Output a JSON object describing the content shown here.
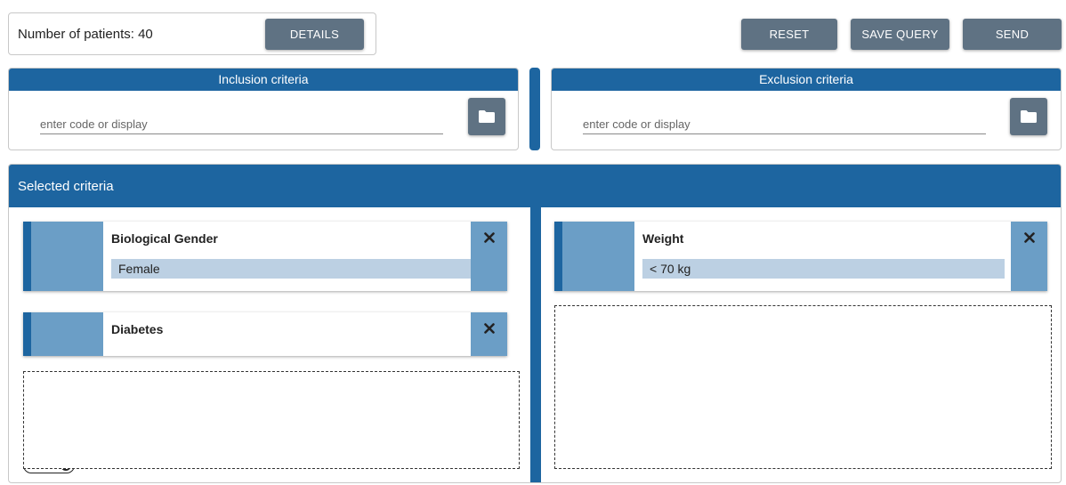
{
  "header": {
    "patients_label": "Number of patients: 40",
    "details_label": "DETAILS",
    "reset_label": "RESET",
    "save_query_label": "SAVE QUERY",
    "send_label": "SEND"
  },
  "inclusion": {
    "title": "Inclusion criteria",
    "placeholder": "enter code or display",
    "browse_icon": "folder-icon"
  },
  "exclusion": {
    "title": "Exclusion criteria",
    "placeholder": "enter code or display",
    "browse_icon": "folder-icon"
  },
  "selected": {
    "title": "Selected criteria",
    "inclusion_items": [
      {
        "title": "Biological Gender",
        "value": "Female"
      },
      {
        "title": "Diabetes"
      }
    ],
    "connector_label": "AND",
    "exclusion_items": [
      {
        "title": "Weight",
        "value": "< 70 kg"
      }
    ]
  },
  "colors": {
    "primary": "#1d65a0",
    "button": "#5f7283",
    "card_accent": "#6b9ec6",
    "value_bg": "#bcd0e3"
  }
}
